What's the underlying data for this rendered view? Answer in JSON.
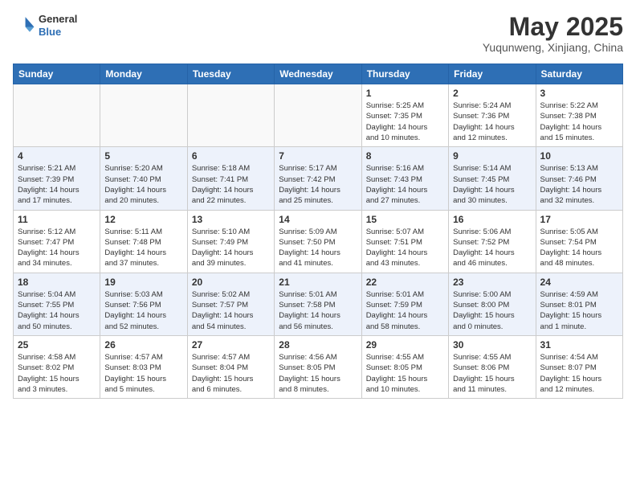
{
  "header": {
    "logo_line1": "General",
    "logo_line2": "Blue",
    "month_year": "May 2025",
    "location": "Yuqunweng, Xinjiang, China"
  },
  "weekdays": [
    "Sunday",
    "Monday",
    "Tuesday",
    "Wednesday",
    "Thursday",
    "Friday",
    "Saturday"
  ],
  "weeks": [
    [
      {
        "day": "",
        "detail": ""
      },
      {
        "day": "",
        "detail": ""
      },
      {
        "day": "",
        "detail": ""
      },
      {
        "day": "",
        "detail": ""
      },
      {
        "day": "1",
        "detail": "Sunrise: 5:25 AM\nSunset: 7:35 PM\nDaylight: 14 hours\nand 10 minutes."
      },
      {
        "day": "2",
        "detail": "Sunrise: 5:24 AM\nSunset: 7:36 PM\nDaylight: 14 hours\nand 12 minutes."
      },
      {
        "day": "3",
        "detail": "Sunrise: 5:22 AM\nSunset: 7:38 PM\nDaylight: 14 hours\nand 15 minutes."
      }
    ],
    [
      {
        "day": "4",
        "detail": "Sunrise: 5:21 AM\nSunset: 7:39 PM\nDaylight: 14 hours\nand 17 minutes."
      },
      {
        "day": "5",
        "detail": "Sunrise: 5:20 AM\nSunset: 7:40 PM\nDaylight: 14 hours\nand 20 minutes."
      },
      {
        "day": "6",
        "detail": "Sunrise: 5:18 AM\nSunset: 7:41 PM\nDaylight: 14 hours\nand 22 minutes."
      },
      {
        "day": "7",
        "detail": "Sunrise: 5:17 AM\nSunset: 7:42 PM\nDaylight: 14 hours\nand 25 minutes."
      },
      {
        "day": "8",
        "detail": "Sunrise: 5:16 AM\nSunset: 7:43 PM\nDaylight: 14 hours\nand 27 minutes."
      },
      {
        "day": "9",
        "detail": "Sunrise: 5:14 AM\nSunset: 7:45 PM\nDaylight: 14 hours\nand 30 minutes."
      },
      {
        "day": "10",
        "detail": "Sunrise: 5:13 AM\nSunset: 7:46 PM\nDaylight: 14 hours\nand 32 minutes."
      }
    ],
    [
      {
        "day": "11",
        "detail": "Sunrise: 5:12 AM\nSunset: 7:47 PM\nDaylight: 14 hours\nand 34 minutes."
      },
      {
        "day": "12",
        "detail": "Sunrise: 5:11 AM\nSunset: 7:48 PM\nDaylight: 14 hours\nand 37 minutes."
      },
      {
        "day": "13",
        "detail": "Sunrise: 5:10 AM\nSunset: 7:49 PM\nDaylight: 14 hours\nand 39 minutes."
      },
      {
        "day": "14",
        "detail": "Sunrise: 5:09 AM\nSunset: 7:50 PM\nDaylight: 14 hours\nand 41 minutes."
      },
      {
        "day": "15",
        "detail": "Sunrise: 5:07 AM\nSunset: 7:51 PM\nDaylight: 14 hours\nand 43 minutes."
      },
      {
        "day": "16",
        "detail": "Sunrise: 5:06 AM\nSunset: 7:52 PM\nDaylight: 14 hours\nand 46 minutes."
      },
      {
        "day": "17",
        "detail": "Sunrise: 5:05 AM\nSunset: 7:54 PM\nDaylight: 14 hours\nand 48 minutes."
      }
    ],
    [
      {
        "day": "18",
        "detail": "Sunrise: 5:04 AM\nSunset: 7:55 PM\nDaylight: 14 hours\nand 50 minutes."
      },
      {
        "day": "19",
        "detail": "Sunrise: 5:03 AM\nSunset: 7:56 PM\nDaylight: 14 hours\nand 52 minutes."
      },
      {
        "day": "20",
        "detail": "Sunrise: 5:02 AM\nSunset: 7:57 PM\nDaylight: 14 hours\nand 54 minutes."
      },
      {
        "day": "21",
        "detail": "Sunrise: 5:01 AM\nSunset: 7:58 PM\nDaylight: 14 hours\nand 56 minutes."
      },
      {
        "day": "22",
        "detail": "Sunrise: 5:01 AM\nSunset: 7:59 PM\nDaylight: 14 hours\nand 58 minutes."
      },
      {
        "day": "23",
        "detail": "Sunrise: 5:00 AM\nSunset: 8:00 PM\nDaylight: 15 hours\nand 0 minutes."
      },
      {
        "day": "24",
        "detail": "Sunrise: 4:59 AM\nSunset: 8:01 PM\nDaylight: 15 hours\nand 1 minute."
      }
    ],
    [
      {
        "day": "25",
        "detail": "Sunrise: 4:58 AM\nSunset: 8:02 PM\nDaylight: 15 hours\nand 3 minutes."
      },
      {
        "day": "26",
        "detail": "Sunrise: 4:57 AM\nSunset: 8:03 PM\nDaylight: 15 hours\nand 5 minutes."
      },
      {
        "day": "27",
        "detail": "Sunrise: 4:57 AM\nSunset: 8:04 PM\nDaylight: 15 hours\nand 6 minutes."
      },
      {
        "day": "28",
        "detail": "Sunrise: 4:56 AM\nSunset: 8:05 PM\nDaylight: 15 hours\nand 8 minutes."
      },
      {
        "day": "29",
        "detail": "Sunrise: 4:55 AM\nSunset: 8:05 PM\nDaylight: 15 hours\nand 10 minutes."
      },
      {
        "day": "30",
        "detail": "Sunrise: 4:55 AM\nSunset: 8:06 PM\nDaylight: 15 hours\nand 11 minutes."
      },
      {
        "day": "31",
        "detail": "Sunrise: 4:54 AM\nSunset: 8:07 PM\nDaylight: 15 hours\nand 12 minutes."
      }
    ]
  ]
}
